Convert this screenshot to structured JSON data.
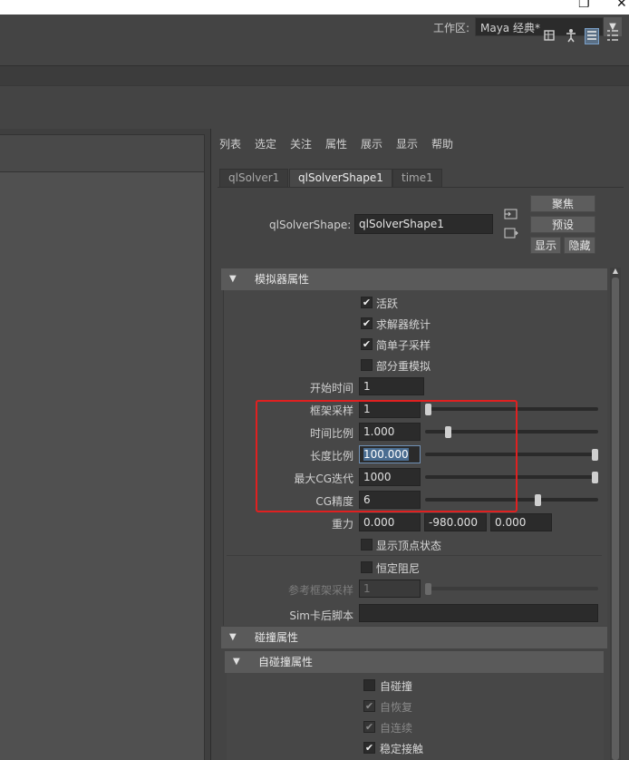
{
  "window": {
    "restore_glyph": "❐",
    "close_glyph": "✕"
  },
  "workspace": {
    "label": "工作区:",
    "value": "Maya 经典*"
  },
  "toolbar": {
    "icons": [
      "sculpt-icon",
      "figure-icon",
      "attribute-editor-icon",
      "channel-list-icon"
    ]
  },
  "ae": {
    "menu": [
      "列表",
      "选定",
      "关注",
      "属性",
      "展示",
      "显示",
      "帮助"
    ],
    "tabs": [
      {
        "label": "qlSolver1"
      },
      {
        "label": "qlSolverShape1"
      },
      {
        "label": "time1"
      }
    ],
    "shape_label": "qlSolverShape:",
    "shape_value": "qlSolverShape1",
    "buttons": {
      "focus": "聚焦",
      "preset": "预设",
      "show": "显示",
      "hide": "隐藏"
    }
  },
  "sections": {
    "simulator": "模拟器属性",
    "collision": "碰撞属性",
    "self_collision": "自碰撞属性"
  },
  "checkboxes": {
    "active": {
      "label": "活跃",
      "checked": true
    },
    "solver_stats": {
      "label": "求解器统计",
      "checked": true
    },
    "simple_subsample": {
      "label": "简单子采样",
      "checked": true
    },
    "partial_weight": {
      "label": "部分重模拟",
      "checked": false
    },
    "show_vertex_state": {
      "label": "显示顶点状态",
      "checked": false
    },
    "const_damping": {
      "label": "恒定阻尼",
      "checked": false
    },
    "self_collide": {
      "label": "自碰撞",
      "checked": false
    },
    "self_recover": {
      "label": "自恢复",
      "checked": true
    },
    "self_continuous": {
      "label": "自连续",
      "checked": true
    },
    "stable_contact": {
      "label": "稳定接触",
      "checked": true
    }
  },
  "attrs": {
    "start_time": {
      "label": "开始时间",
      "value": "1"
    },
    "frame_samples": {
      "label": "框架采样",
      "value": "1",
      "slider": 0.0
    },
    "time_scale": {
      "label": "时间比例",
      "value": "1.000",
      "slider": 0.12
    },
    "length_scale": {
      "label": "长度比例",
      "value": "100.000",
      "slider": 1.0
    },
    "max_cg_iter": {
      "label": "最大CG迭代",
      "value": "1000",
      "slider": 1.0
    },
    "cg_accuracy": {
      "label": "CG精度",
      "value": "6",
      "slider": 0.66
    },
    "gravity": {
      "label": "重力",
      "x": "0.000",
      "y": "-980.000",
      "z": "0.000"
    },
    "ref_frame_samples": {
      "label": "参考框架采样",
      "value": "1",
      "slider": 0.0
    },
    "post_sim_script": {
      "label": "Sim卡后脚本",
      "value": ""
    }
  },
  "icons": {
    "section_arrow": "▼",
    "check": "✔",
    "scroll_up": "▲",
    "dropdown": "▼",
    "load_attr": "⊡",
    "copy_tab": "⊡"
  },
  "colors": {
    "highlight": "#e02020",
    "selection": "#4a6d91"
  }
}
